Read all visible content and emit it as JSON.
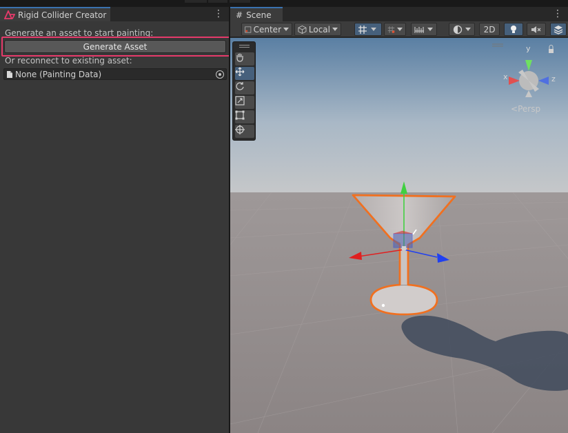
{
  "left_panel": {
    "tab_title": "Rigid Collider Creator",
    "generate_prompt": "Generate an asset to start painting:",
    "generate_button": "Generate Asset",
    "reconnect_prompt": "Or reconnect to existing asset:",
    "asset_field_value": "None (Painting Data)"
  },
  "scene_panel": {
    "tab_title": "Scene",
    "toolbar": {
      "pivot_mode": "Center",
      "pivot_rotation": "Local",
      "view_2d": "2D"
    },
    "gizmo": {
      "axis_y": "y",
      "axis_x": "x",
      "axis_z": "z",
      "projection": "Persp"
    }
  },
  "colors": {
    "highlight": "#e73a6b",
    "selection_outline": "#f07020",
    "axis_x": "#e02020",
    "axis_y": "#40d040",
    "axis_z": "#2040f0"
  }
}
